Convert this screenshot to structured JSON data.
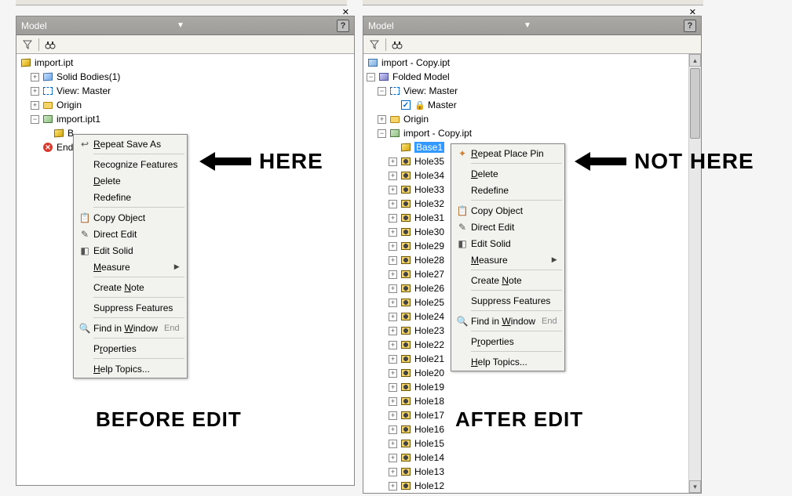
{
  "panels": {
    "left": {
      "title": "Model"
    },
    "right": {
      "title": "Model"
    }
  },
  "tree_left": {
    "root": "import.ipt",
    "items": {
      "solid_bodies": "Solid Bodies(1)",
      "view_master": "View: Master",
      "origin": "Origin",
      "import_sub": "import.ipt1",
      "base": "B",
      "end": "End o"
    }
  },
  "tree_right": {
    "root": "import - Copy.ipt",
    "folded_model": "Folded Model",
    "view_master": "View: Master",
    "master": "Master",
    "origin": "Origin",
    "import_sub": "import - Copy.ipt",
    "base_sel": "Base1",
    "holes": [
      "Hole35",
      "Hole34",
      "Hole33",
      "Hole32",
      "Hole31",
      "Hole30",
      "Hole29",
      "Hole28",
      "Hole27",
      "Hole26",
      "Hole25",
      "Hole24",
      "Hole23",
      "Hole22",
      "Hole21",
      "Hole20",
      "Hole19",
      "Hole18",
      "Hole17",
      "Hole16",
      "Hole15",
      "Hole14",
      "Hole13",
      "Hole12"
    ]
  },
  "menu_left": {
    "items": {
      "repeat": "Repeat Save As",
      "recognize": "Recognize Features",
      "delete": "Delete",
      "redefine": "Redefine",
      "copy_object": "Copy Object",
      "direct_edit": "Direct Edit",
      "edit_solid": "Edit Solid",
      "measure": "Measure",
      "create_note": "Create Note",
      "suppress": "Suppress Features",
      "find_window": "Find in Window",
      "find_end": "End",
      "properties": "Properties",
      "help": "Help Topics..."
    }
  },
  "menu_right": {
    "items": {
      "repeat": "Repeat Place Pin",
      "delete": "Delete",
      "redefine": "Redefine",
      "copy_object": "Copy Object",
      "direct_edit": "Direct Edit",
      "edit_solid": "Edit Solid",
      "measure": "Measure",
      "create_note": "Create Note",
      "suppress": "Suppress Features",
      "find_window": "Find in Window",
      "find_end": "End",
      "properties": "Properties",
      "help": "Help Topics..."
    }
  },
  "annotations": {
    "here": "HERE",
    "not_here": "NOT HERE",
    "before": "BEFORE EDIT",
    "after": "AFTER EDIT"
  }
}
